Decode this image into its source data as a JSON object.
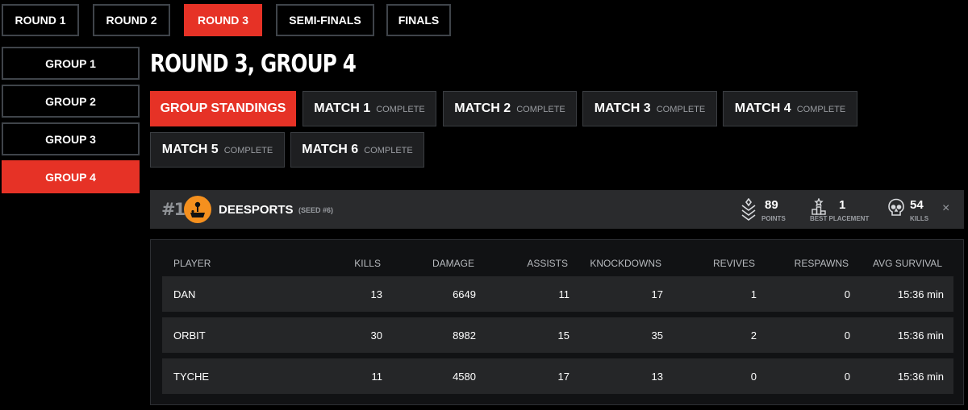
{
  "round_tabs": [
    "ROUND 1",
    "ROUND 2",
    "ROUND 3",
    "SEMI-FINALS",
    "FINALS"
  ],
  "active_round": "ROUND 3",
  "group_tabs": [
    "GROUP 1",
    "GROUP 2",
    "GROUP 3",
    "GROUP 4"
  ],
  "active_group": "GROUP 4",
  "page_title": "ROUND 3, GROUP 4",
  "match_tabs": [
    {
      "label": "GROUP STANDINGS",
      "status": ""
    },
    {
      "label": "MATCH 1",
      "status": "COMPLETE"
    },
    {
      "label": "MATCH 2",
      "status": "COMPLETE"
    },
    {
      "label": "MATCH 3",
      "status": "COMPLETE"
    },
    {
      "label": "MATCH 4",
      "status": "COMPLETE"
    },
    {
      "label": "MATCH 5",
      "status": "COMPLETE"
    },
    {
      "label": "MATCH 6",
      "status": "COMPLETE"
    }
  ],
  "team": {
    "rank": "#1",
    "name": "DEESPORTS",
    "seed": "(SEED #6)",
    "logo_icon": "joystick-icon",
    "stats": [
      {
        "icon": "chevron-rank-icon",
        "value": "89",
        "label": "POINTS"
      },
      {
        "icon": "podium-icon",
        "value": "1",
        "label": "BEST PLACEMENT"
      },
      {
        "icon": "skull-icon",
        "value": "54",
        "label": "KILLS"
      }
    ],
    "close_symbol": "×"
  },
  "table": {
    "headers": [
      "PLAYER",
      "KILLS",
      "DAMAGE",
      "ASSISTS",
      "KNOCKDOWNS",
      "REVIVES",
      "RESPAWNS",
      "AVG SURVIVAL"
    ],
    "rows": [
      [
        "DAN",
        "13",
        "6649",
        "11",
        "17",
        "1",
        "0",
        "15:36 min"
      ],
      [
        "ORBIT",
        "30",
        "8982",
        "15",
        "35",
        "2",
        "0",
        "15:36 min"
      ],
      [
        "TYCHE",
        "11",
        "4580",
        "17",
        "13",
        "0",
        "0",
        "15:36 min"
      ]
    ]
  },
  "colors": {
    "accent": "#e63226",
    "background": "#000000",
    "panel": "#2a2b2d",
    "logo": "#f5901e"
  }
}
